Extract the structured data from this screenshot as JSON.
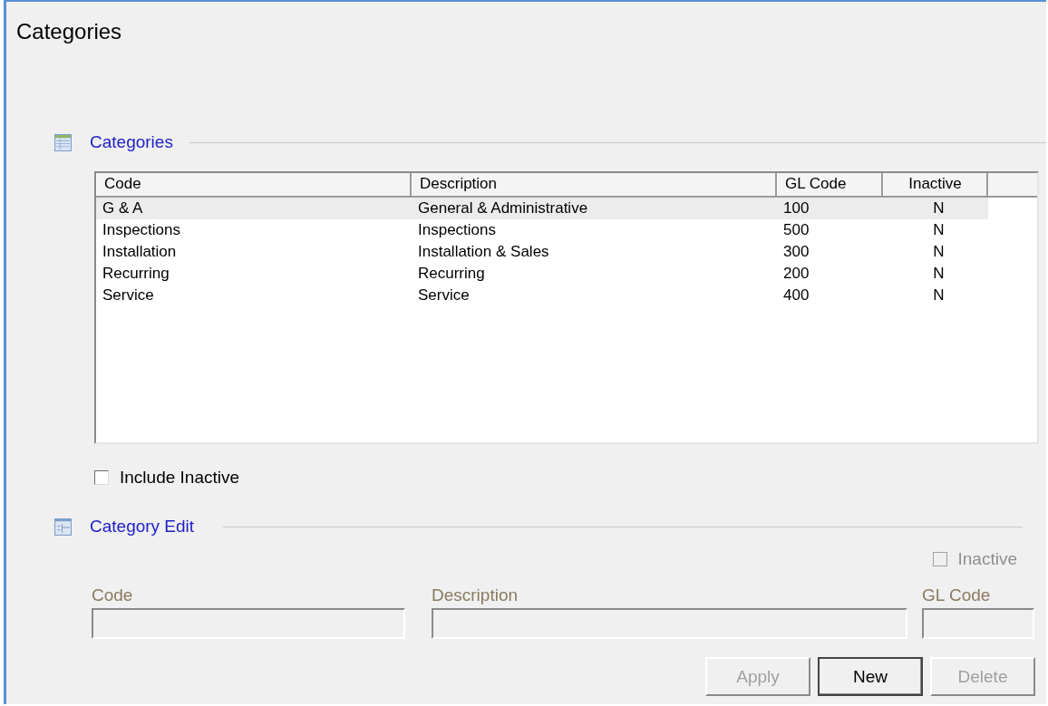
{
  "window": {
    "title": "Categories"
  },
  "list_section": {
    "title": "Categories"
  },
  "table": {
    "columns": [
      "Code",
      "Description",
      "GL Code",
      "Inactive"
    ],
    "rows": [
      {
        "cells": [
          "G & A",
          "General & Administrative",
          "100",
          "N"
        ],
        "selected": true
      },
      {
        "cells": [
          "Inspections",
          "Inspections",
          "500",
          "N"
        ],
        "selected": false
      },
      {
        "cells": [
          "Installation",
          "Installation & Sales",
          "300",
          "N"
        ],
        "selected": false
      },
      {
        "cells": [
          "Recurring",
          "Recurring",
          "200",
          "N"
        ],
        "selected": false
      },
      {
        "cells": [
          "Service",
          "Service",
          "400",
          "N"
        ],
        "selected": false
      }
    ]
  },
  "include_inactive": {
    "label": "Include Inactive",
    "checked": false,
    "disabled": false
  },
  "edit_section": {
    "title": "Category Edit"
  },
  "inactive": {
    "label": "Inactive",
    "checked": false,
    "disabled": true
  },
  "fields": [
    {
      "label": "Code",
      "disabled": true
    },
    {
      "label": "Description",
      "disabled": true
    },
    {
      "label": "GL Code",
      "disabled": true
    }
  ],
  "buttons": [
    {
      "label": "Apply",
      "disabled": true,
      "default": false
    },
    {
      "label": "New",
      "disabled": false,
      "default": true
    },
    {
      "label": "Delete",
      "disabled": true,
      "default": false
    }
  ]
}
